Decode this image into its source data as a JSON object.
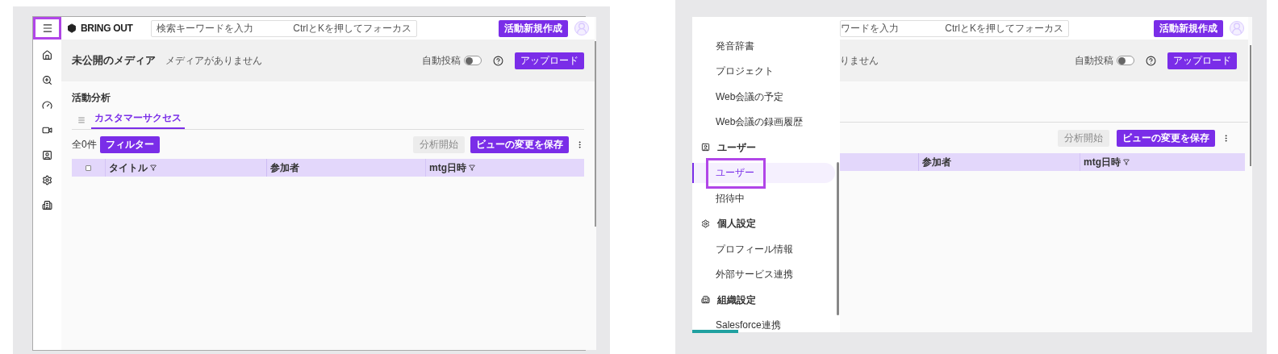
{
  "left_screen": {
    "sidebar": {
      "menu_highlighted": true
    },
    "header": {
      "logo": "BRING OUT",
      "search": {
        "placeholder": "検索キーワードを入力",
        "shortcut_hint": "CtrlとKを押してフォーカス"
      },
      "create_button": "活動新規作成"
    },
    "media_bar": {
      "title": "未公開のメディア",
      "subtitle": "メディアがありません",
      "auto_post": {
        "label": "自動投稿",
        "on": false
      },
      "upload_button": "アップロード"
    },
    "section_title": "活動分析",
    "tabs": [
      {
        "label": "カスタマーサクセス",
        "selected": true
      }
    ],
    "toolbar": {
      "count": "全0件",
      "filter_button": "フィルター",
      "analyze_button": {
        "label": "分析開始",
        "disabled": true
      },
      "save_view_button": "ビューの変更を保存"
    },
    "table": {
      "select_all_checked": false,
      "columns": [
        {
          "label": "タイトル",
          "filter": true
        },
        {
          "label": "参加者",
          "filter": false
        },
        {
          "label": "mtg日時",
          "filter": true
        }
      ]
    }
  },
  "right_screen": {
    "drawer": {
      "items": [
        {
          "kind": "item",
          "label": "発音辞書",
          "selected": false,
          "highlighted": false
        },
        {
          "kind": "item",
          "label": "プロジェクト",
          "selected": false,
          "highlighted": false
        },
        {
          "kind": "item",
          "label": "Web会議の予定",
          "selected": false,
          "highlighted": false
        },
        {
          "kind": "item",
          "label": "Web会議の録画履歴",
          "selected": false,
          "highlighted": false
        },
        {
          "kind": "section",
          "label": "ユーザー"
        },
        {
          "kind": "item",
          "label": "ユーザー",
          "selected": true,
          "highlighted": true
        },
        {
          "kind": "item",
          "label": "招待中",
          "selected": false,
          "highlighted": false
        },
        {
          "kind": "section",
          "label": "個人設定"
        },
        {
          "kind": "item",
          "label": "プロフィール情報",
          "selected": false,
          "highlighted": false
        },
        {
          "kind": "item",
          "label": "外部サービス連携",
          "selected": false,
          "highlighted": false
        },
        {
          "kind": "section",
          "label": "組織設定"
        },
        {
          "kind": "item",
          "label": "Salesforce連携",
          "selected": false,
          "highlighted": false
        }
      ]
    },
    "header": {
      "search": {
        "placeholder": "ワードを入力",
        "shortcut_hint": "CtrlとKを押してフォーカス"
      },
      "create_button": "活動新規作成"
    },
    "media_bar": {
      "subtitle": "りません",
      "auto_post": {
        "label": "自動投稿",
        "on": false
      },
      "upload_button": "アップロード"
    },
    "toolbar": {
      "analyze_button": {
        "label": "分析開始",
        "disabled": true
      },
      "save_view_button": "ビューの変更を保存"
    },
    "table": {
      "columns": [
        {
          "label": "参加者",
          "filter": false
        },
        {
          "label": "mtg日時",
          "filter": true
        }
      ]
    }
  }
}
